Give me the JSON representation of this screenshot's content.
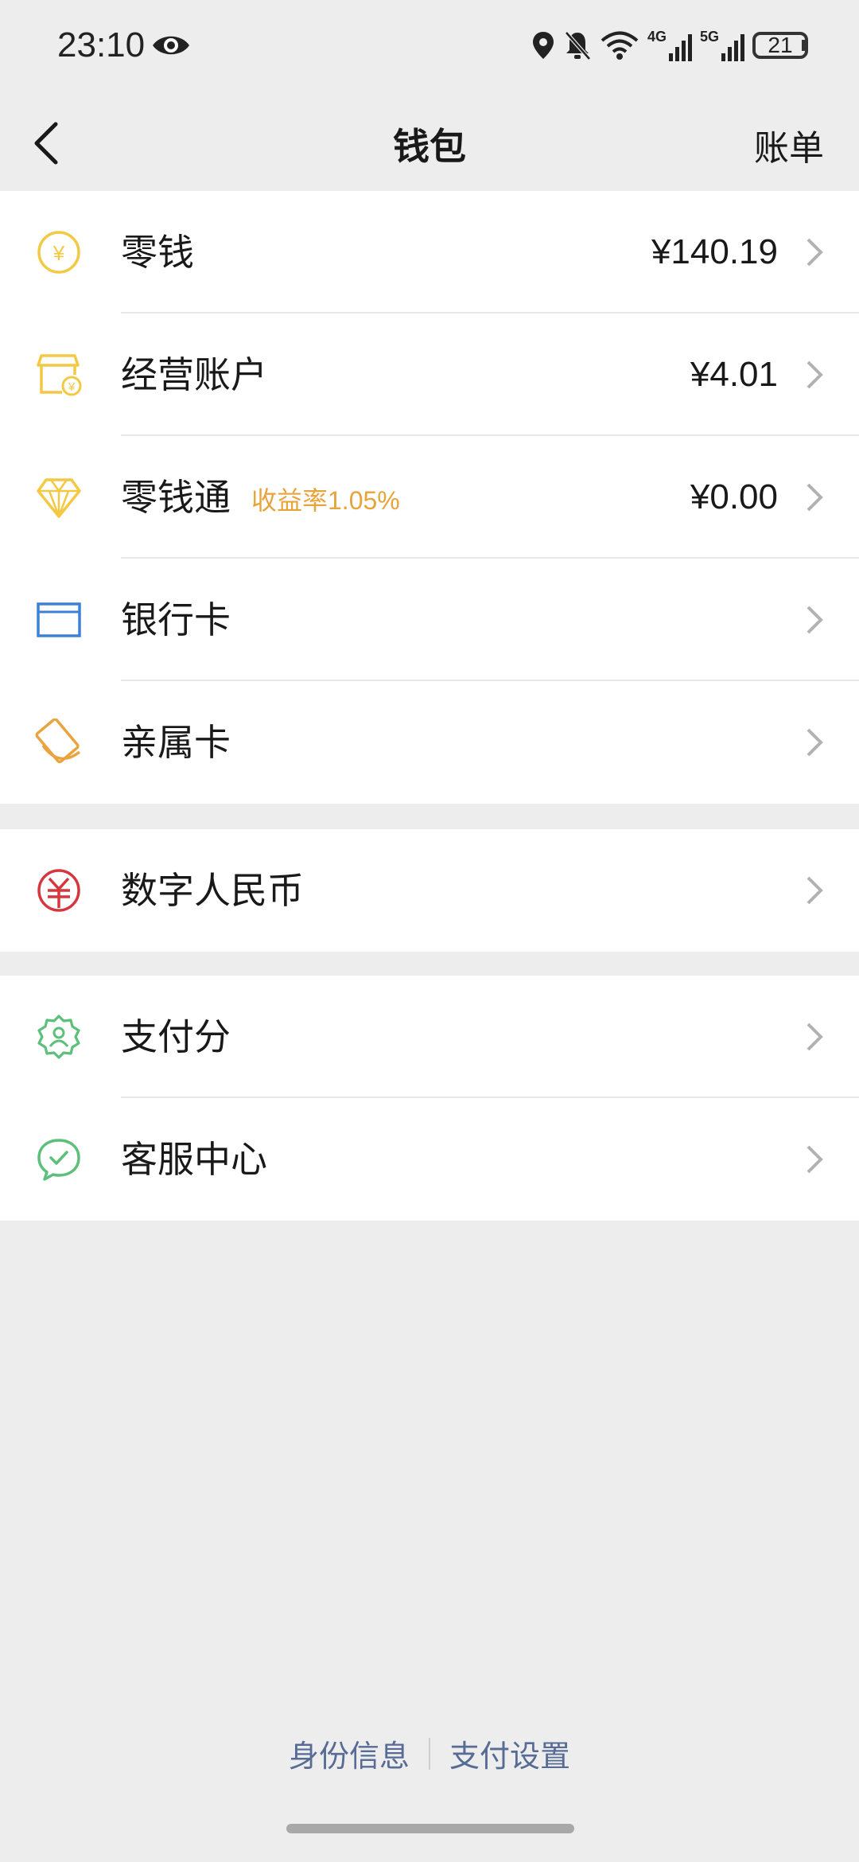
{
  "status": {
    "time": "23:10",
    "network1": "4G",
    "network2": "5G",
    "battery": "21"
  },
  "nav": {
    "title": "钱包",
    "right": "账单"
  },
  "groups": [
    {
      "rows": [
        {
          "label": "零钱",
          "sublabel": "",
          "value": "¥140.19",
          "icon": "coin-icon"
        },
        {
          "label": "经营账户",
          "sublabel": "",
          "value": "¥4.01",
          "icon": "shop-account-icon"
        },
        {
          "label": "零钱通",
          "sublabel": "收益率1.05%",
          "value": "¥0.00",
          "icon": "diamond-icon"
        },
        {
          "label": "银行卡",
          "sublabel": "",
          "value": "",
          "icon": "bank-card-icon"
        },
        {
          "label": "亲属卡",
          "sublabel": "",
          "value": "",
          "icon": "family-card-icon"
        }
      ]
    },
    {
      "rows": [
        {
          "label": "数字人民币",
          "sublabel": "",
          "value": "",
          "icon": "digital-rmb-icon"
        }
      ]
    },
    {
      "rows": [
        {
          "label": "支付分",
          "sublabel": "",
          "value": "",
          "icon": "pay-score-icon"
        },
        {
          "label": "客服中心",
          "sublabel": "",
          "value": "",
          "icon": "customer-service-icon"
        }
      ]
    }
  ],
  "footer": {
    "link1": "身份信息",
    "link2": "支付设置"
  },
  "colors": {
    "background": "#ededed",
    "link": "#576b95",
    "accent_orange": "#e8a33a",
    "icon_yellow": "#f3c944",
    "icon_blue": "#3b82d6",
    "icon_red": "#d6363d",
    "icon_green": "#5cc07a"
  }
}
